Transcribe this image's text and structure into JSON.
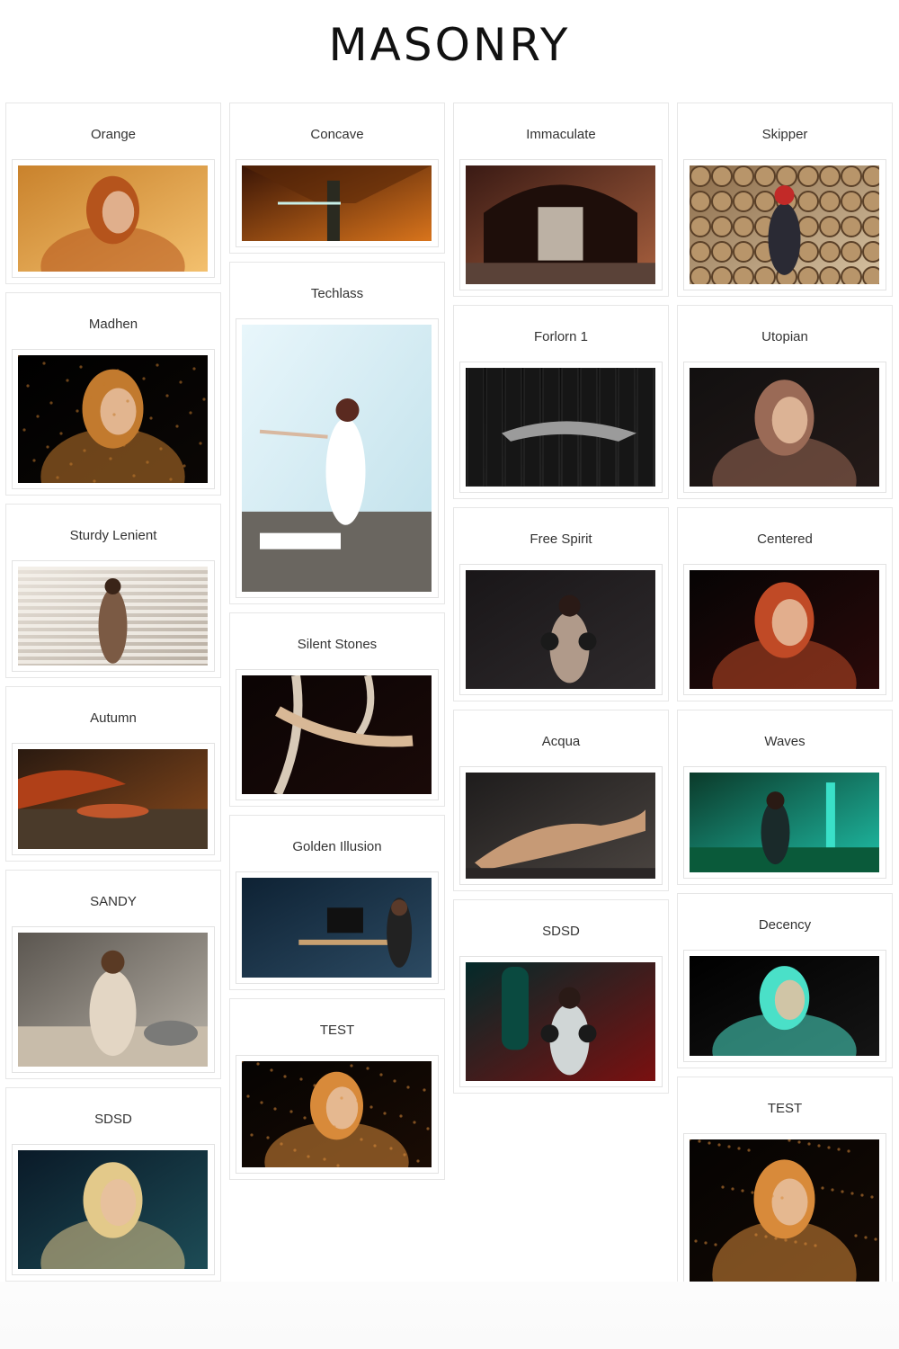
{
  "header": {
    "title": "MASONRY"
  },
  "columns": [
    {
      "items": [
        {
          "name": "orange-card",
          "title": "Orange",
          "h": 118,
          "bg": [
            "#c9822c",
            "#f3c06e"
          ],
          "fg": "#b5541c",
          "subject": "portrait"
        },
        {
          "name": "madhen-card",
          "title": "Madhen",
          "h": 142,
          "bg": [
            "#000000",
            "#0b0705"
          ],
          "fg": "#c27a2e",
          "subject": "dust-portrait"
        },
        {
          "name": "sturdy-lenient-card",
          "title": "Sturdy Lenient",
          "h": 110,
          "bg": [
            "#e8e2da",
            "#b8aea2"
          ],
          "fg": "#7b5a44",
          "subject": "blinds"
        },
        {
          "name": "autumn-card",
          "title": "Autumn",
          "h": 111,
          "bg": [
            "#2a1a10",
            "#8a4a1c"
          ],
          "fg": "#c0562b",
          "subject": "autumn"
        },
        {
          "name": "sandy-card",
          "title": "SANDY",
          "h": 149,
          "bg": [
            "#5b5650",
            "#b8b2a8"
          ],
          "fg": "#e3d6c4",
          "subject": "beach"
        },
        {
          "name": "sdsd-card-col1",
          "title": "SDSD",
          "h": 132,
          "bg": [
            "#0a1a28",
            "#1d4c56"
          ],
          "fg": "#e3c98a",
          "subject": "teal-portrait"
        }
      ]
    },
    {
      "items": [
        {
          "name": "concave-card",
          "title": "Concave",
          "h": 84,
          "bg": [
            "#3a1506",
            "#d8741c"
          ],
          "fg": "#2a2a20",
          "subject": "tunnel"
        },
        {
          "name": "techlass-card",
          "title": "Techlass",
          "h": 297,
          "bg": [
            "#e8f6fb",
            "#bfe0ea"
          ],
          "fg": "#ffffff",
          "subject": "dancer"
        },
        {
          "name": "silent-stones-card",
          "title": "Silent Stones",
          "h": 132,
          "bg": [
            "#0b0404",
            "#1a0a08"
          ],
          "fg": "#d8b896",
          "subject": "aerial"
        },
        {
          "name": "golden-illusion-card",
          "title": "Golden Illusion",
          "h": 111,
          "bg": [
            "#0e2234",
            "#2c4a62"
          ],
          "fg": "#9aa6ae",
          "subject": "desk"
        },
        {
          "name": "test-card-col2",
          "title": "TEST",
          "h": 118,
          "bg": [
            "#050302",
            "#1a0c04"
          ],
          "fg": "#d88a3a",
          "subject": "dust-portrait"
        }
      ]
    },
    {
      "items": [
        {
          "name": "immaculate-card",
          "title": "Immaculate",
          "h": 132,
          "bg": [
            "#3a1a14",
            "#a8603e"
          ],
          "fg": "#f2e8d8",
          "subject": "arch"
        },
        {
          "name": "forlorn-card",
          "title": "Forlorn 1",
          "h": 132,
          "bg": [
            "#050505",
            "#222222"
          ],
          "fg": "#9b9b9b",
          "subject": "lockers"
        },
        {
          "name": "free-spirit-card",
          "title": "Free Spirit",
          "h": 132,
          "bg": [
            "#191618",
            "#2e2a2c"
          ],
          "fg": "#b09a8a",
          "subject": "boxer"
        },
        {
          "name": "acqua-card",
          "title": "Acqua",
          "h": 118,
          "bg": [
            "#1e1c1c",
            "#4a4440"
          ],
          "fg": "#c69a76",
          "subject": "reclining"
        },
        {
          "name": "sdsd-card-col3",
          "title": "SDSD",
          "h": 132,
          "bg": [
            "#032a2a",
            "#7a1010"
          ],
          "fg": "#d0d6d6",
          "subject": "boxing-bag"
        }
      ]
    },
    {
      "items": [
        {
          "name": "skipper-card",
          "title": "Skipper",
          "h": 132,
          "bg": [
            "#8a6a48",
            "#d8c4a4"
          ],
          "fg": "#c22a28",
          "subject": "logs"
        },
        {
          "name": "utopian-card",
          "title": "Utopian",
          "h": 132,
          "bg": [
            "#121010",
            "#241a18"
          ],
          "fg": "#9a6a56",
          "subject": "portrait-dark"
        },
        {
          "name": "centered-card",
          "title": "Centered",
          "h": 132,
          "bg": [
            "#060404",
            "#2a0a0a"
          ],
          "fg": "#c04a26",
          "subject": "red-portrait"
        },
        {
          "name": "waves-card",
          "title": "Waves",
          "h": 111,
          "bg": [
            "#0b3a2a",
            "#1fc0a8"
          ],
          "fg": "#0f1a1a",
          "subject": "teal-forest"
        },
        {
          "name": "decency-card",
          "title": "Decency",
          "h": 111,
          "bg": [
            "#000000",
            "#151515"
          ],
          "fg": "#4ae0c8",
          "subject": "portrait-dark"
        },
        {
          "name": "test-card-col4",
          "title": "TEST",
          "h": 158,
          "bg": [
            "#050302",
            "#140a04"
          ],
          "fg": "#d88a3a",
          "subject": "dust-portrait"
        }
      ]
    }
  ]
}
